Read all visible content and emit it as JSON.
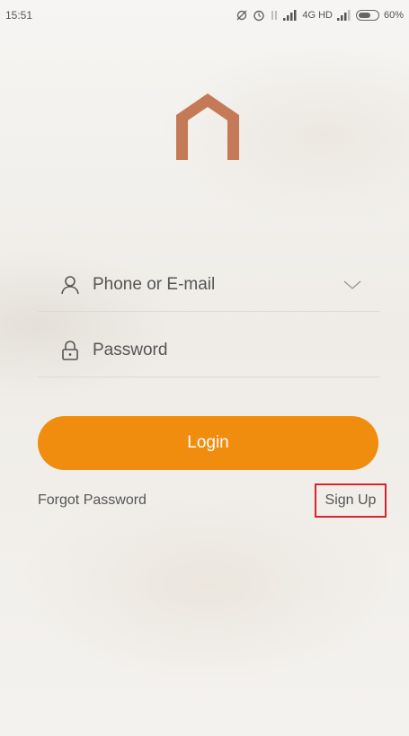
{
  "status_bar": {
    "time": "15:51",
    "network": "4G HD",
    "battery": "60%"
  },
  "logo": {
    "icon": "house-arch-logo",
    "color": "#c47a56"
  },
  "form": {
    "username_placeholder": "Phone or E-mail",
    "password_placeholder": "Password",
    "login_label": "Login",
    "forgot_label": "Forgot Password",
    "signup_label": "Sign Up"
  },
  "colors": {
    "accent": "#f08d0f",
    "highlight_box": "#d9232d"
  }
}
